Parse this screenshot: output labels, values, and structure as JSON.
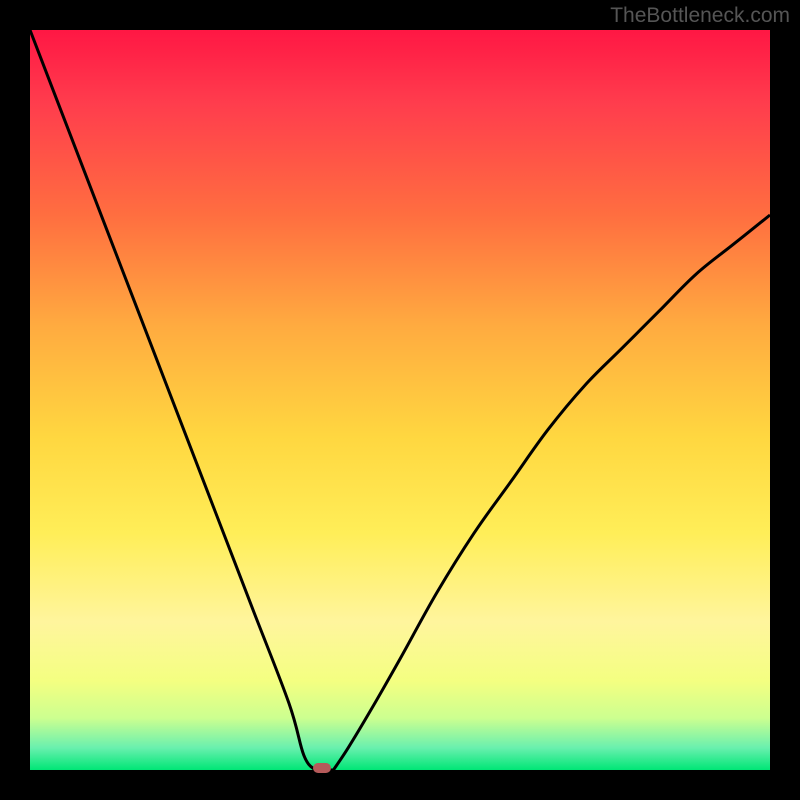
{
  "watermark": "TheBottleneck.com",
  "chart_data": {
    "type": "line",
    "title": "",
    "xlabel": "",
    "ylabel": "",
    "xlim": [
      0,
      100
    ],
    "ylim": [
      0,
      100
    ],
    "series": [
      {
        "name": "bottleneck-curve-left",
        "x": [
          0,
          5,
          10,
          15,
          20,
          25,
          30,
          35,
          37,
          38.5
        ],
        "y": [
          100,
          87,
          74,
          61,
          48,
          35,
          22,
          9,
          2,
          0
        ]
      },
      {
        "name": "bottleneck-curve-right",
        "x": [
          41,
          43,
          46,
          50,
          55,
          60,
          65,
          70,
          75,
          80,
          85,
          90,
          95,
          100
        ],
        "y": [
          0,
          3,
          8,
          15,
          24,
          32,
          39,
          46,
          52,
          57,
          62,
          67,
          71,
          75
        ]
      }
    ],
    "optimal_marker": {
      "x": 39.5,
      "y": 0
    },
    "gradient_stops": [
      {
        "pct": 0,
        "color": "#ff1744"
      },
      {
        "pct": 10,
        "color": "#ff3d4d"
      },
      {
        "pct": 25,
        "color": "#ff6e40"
      },
      {
        "pct": 40,
        "color": "#ffab40"
      },
      {
        "pct": 55,
        "color": "#ffd740"
      },
      {
        "pct": 68,
        "color": "#ffee58"
      },
      {
        "pct": 80,
        "color": "#fff59d"
      },
      {
        "pct": 88,
        "color": "#f4ff81"
      },
      {
        "pct": 93,
        "color": "#ccff90"
      },
      {
        "pct": 97,
        "color": "#69f0ae"
      },
      {
        "pct": 100,
        "color": "#00e676"
      }
    ]
  }
}
